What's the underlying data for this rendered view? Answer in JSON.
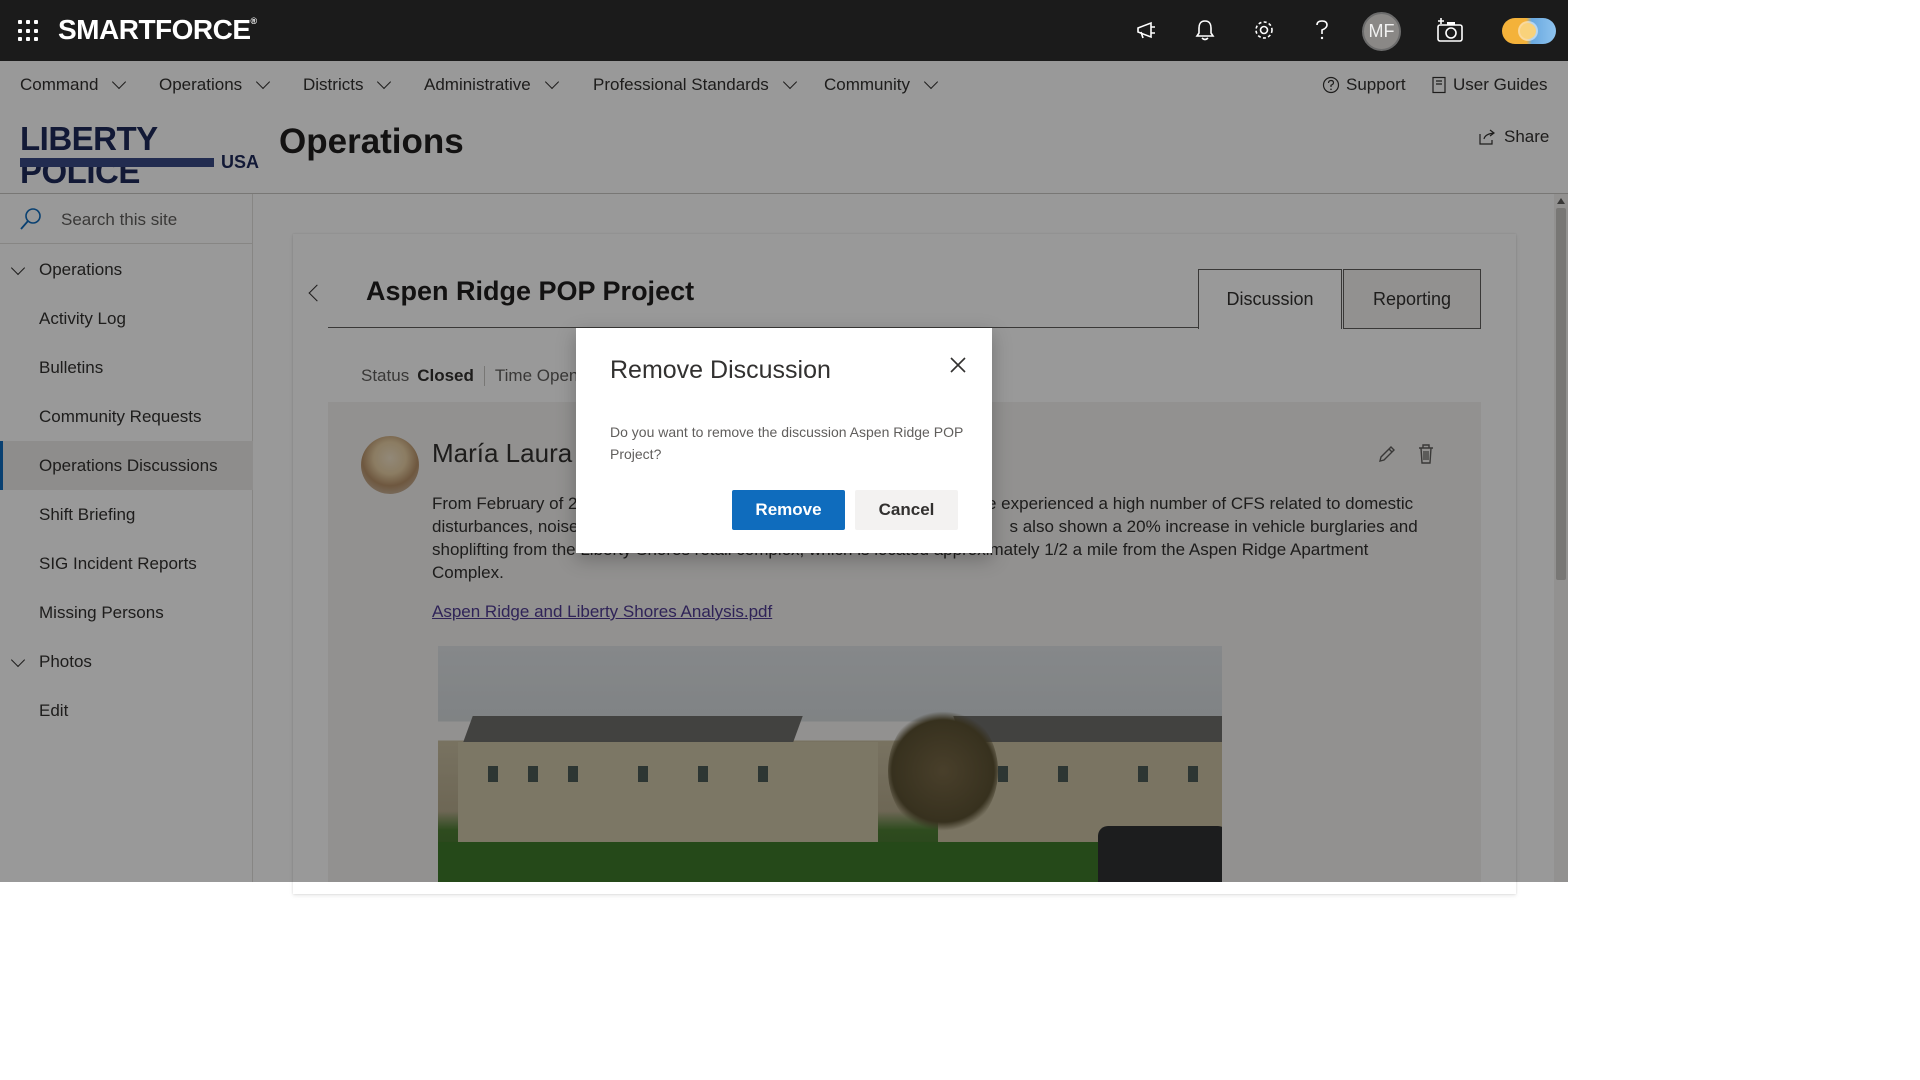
{
  "suitebar": {
    "brand": "SMARTFORCE",
    "brand_mark": "®",
    "avatar_initials": "MF",
    "icons": [
      "megaphone-icon",
      "bell-icon",
      "gear-icon",
      "help-icon",
      "camera-add-icon"
    ]
  },
  "hubnav": {
    "items": [
      {
        "label": "Command"
      },
      {
        "label": "Operations"
      },
      {
        "label": "Districts"
      },
      {
        "label": "Administrative"
      },
      {
        "label": "Professional Standards"
      },
      {
        "label": "Community"
      }
    ],
    "support": "Support",
    "user_guides": "User Guides"
  },
  "site": {
    "logo_text": "LIBERTY POLICE",
    "logo_sub": "USA",
    "title": "Operations",
    "share": "Share"
  },
  "leftnav": {
    "search_placeholder": "Search this site",
    "items": [
      {
        "label": "Operations",
        "type": "header"
      },
      {
        "label": "Activity Log"
      },
      {
        "label": "Bulletins"
      },
      {
        "label": "Community Requests"
      },
      {
        "label": "Operations Discussions",
        "selected": true
      },
      {
        "label": "Shift Briefing"
      },
      {
        "label": "SIG Incident Reports"
      },
      {
        "label": "Missing Persons"
      },
      {
        "label": "Photos",
        "type": "header"
      },
      {
        "label": "Edit"
      }
    ]
  },
  "discussion": {
    "title": "Aspen Ridge POP Project",
    "tabs": [
      {
        "label": "Discussion",
        "active": true
      },
      {
        "label": "Reporting",
        "active": false
      }
    ],
    "status_label": "Status",
    "status_value": "Closed",
    "time_opened_label": "Time Opene",
    "author": "María Laura",
    "body": "From February of 2… [obscured by dialog] …ve experienced a high number of CFS related to domestic disturbances, noise… [obscured] …s also shown a 20% increase in vehicle burglaries and shoplifting from the Liberty Shores retail complex, which is located approximately 1/2 a mile from the Aspen Ridge Apartment Complex.",
    "body_line1_left": "From February of 2",
    "body_line1_right": "ve experienced a high number of CFS related to domestic",
    "body_line2_left": "disturbances, noise",
    "body_line2_right": "s also shown a 20% increase in vehicle burglaries and",
    "body_line3": "shoplifting from the Liberty Shores retail complex, which is located approximately 1/2 a mile from the Aspen Ridge Apartment",
    "body_line4": "Complex.",
    "attachment": "Aspen Ridge and Liberty Shores Analysis.pdf"
  },
  "dialog": {
    "title": "Remove Discussion",
    "message": "Do you want to remove the discussion Aspen Ridge POP Project?",
    "primary_button": "Remove",
    "secondary_button": "Cancel"
  },
  "colors": {
    "suitebar_bg": "#1b1b1b",
    "accent": "#0f6cbd",
    "overlay": "rgba(0,0,0,0.4)"
  }
}
